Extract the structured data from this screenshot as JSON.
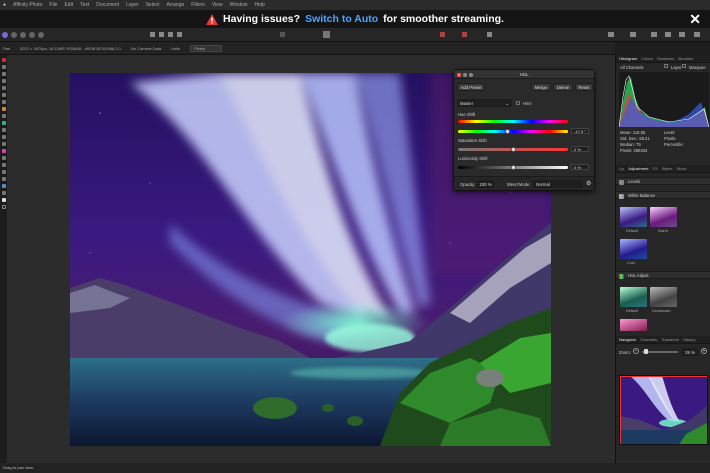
{
  "menubar": {
    "items": [
      "Affinity Photo",
      "File",
      "Edit",
      "Text",
      "Document",
      "Layer",
      "Select",
      "Arrange",
      "Filters",
      "View",
      "Window",
      "Help"
    ]
  },
  "banner": {
    "prefix": "Having issues?",
    "link": "Switch to Auto",
    "suffix": "for smoother streaming.",
    "close": "✕"
  },
  "context": {
    "pers_label": "Pan",
    "doc_info": "5212 × 3476px, 18.11MP, RGBA/8 - sRGB IEC61966-2.1",
    "camera": "No Camera Data",
    "units_label": "Units",
    "units_value": "Pixels"
  },
  "hsl_dialog": {
    "title": "HSL",
    "add_preset": "Add Preset",
    "merge": "Merge",
    "delete": "Delete",
    "reset": "Reset",
    "channel": "Master",
    "hsv_label": "HSV",
    "hue_label": "Hue Shift",
    "hue_value": "-17.9 °",
    "hue_pos": 0.45,
    "sat_label": "Saturation Shift",
    "sat_value": "0 %",
    "sat_pos": 0.5,
    "lum_label": "Luminosity Shift",
    "lum_value": "0 %",
    "lum_pos": 0.5,
    "opacity_label": "Opacity:",
    "opacity_value": "100 %",
    "blend_label": "Blend Mode:",
    "blend_value": "Normal"
  },
  "panel": {
    "tabs_top": [
      "Histogram",
      "Colour",
      "Swatches",
      "Brushes"
    ],
    "channels": "All Channels",
    "layer_label": "Layer",
    "marquee_label": "Marquee",
    "stats": {
      "mean": "Mean: 118.55",
      "std": "Std. Dev.: 68.21",
      "median": "Median: 79",
      "pixels": "Pixels: 288334",
      "level": "Level:",
      "count": "Pixels:",
      "percentile": "Percentile:"
    },
    "tabs_mid": [
      "Lyr",
      "Adjustment",
      "FX",
      "Styles",
      "Stock"
    ],
    "sections": {
      "levels": "Levels",
      "white_balance": "White Balance",
      "hsl_adjust": "HSL Adjust"
    },
    "wb_captions": [
      "Default",
      "Warm",
      "Cool"
    ],
    "hsl_captions": [
      "Default",
      "Desaturate"
    ],
    "tabs_nav": [
      "Navigator",
      "Channels",
      "Transform",
      "History"
    ],
    "zoom_label": "Zoom:",
    "zoom_value": "25 %"
  },
  "status": {
    "hint": "Drag to pan view."
  },
  "colors": {
    "accent": "#4aa6ff",
    "warning": "#e53935"
  }
}
